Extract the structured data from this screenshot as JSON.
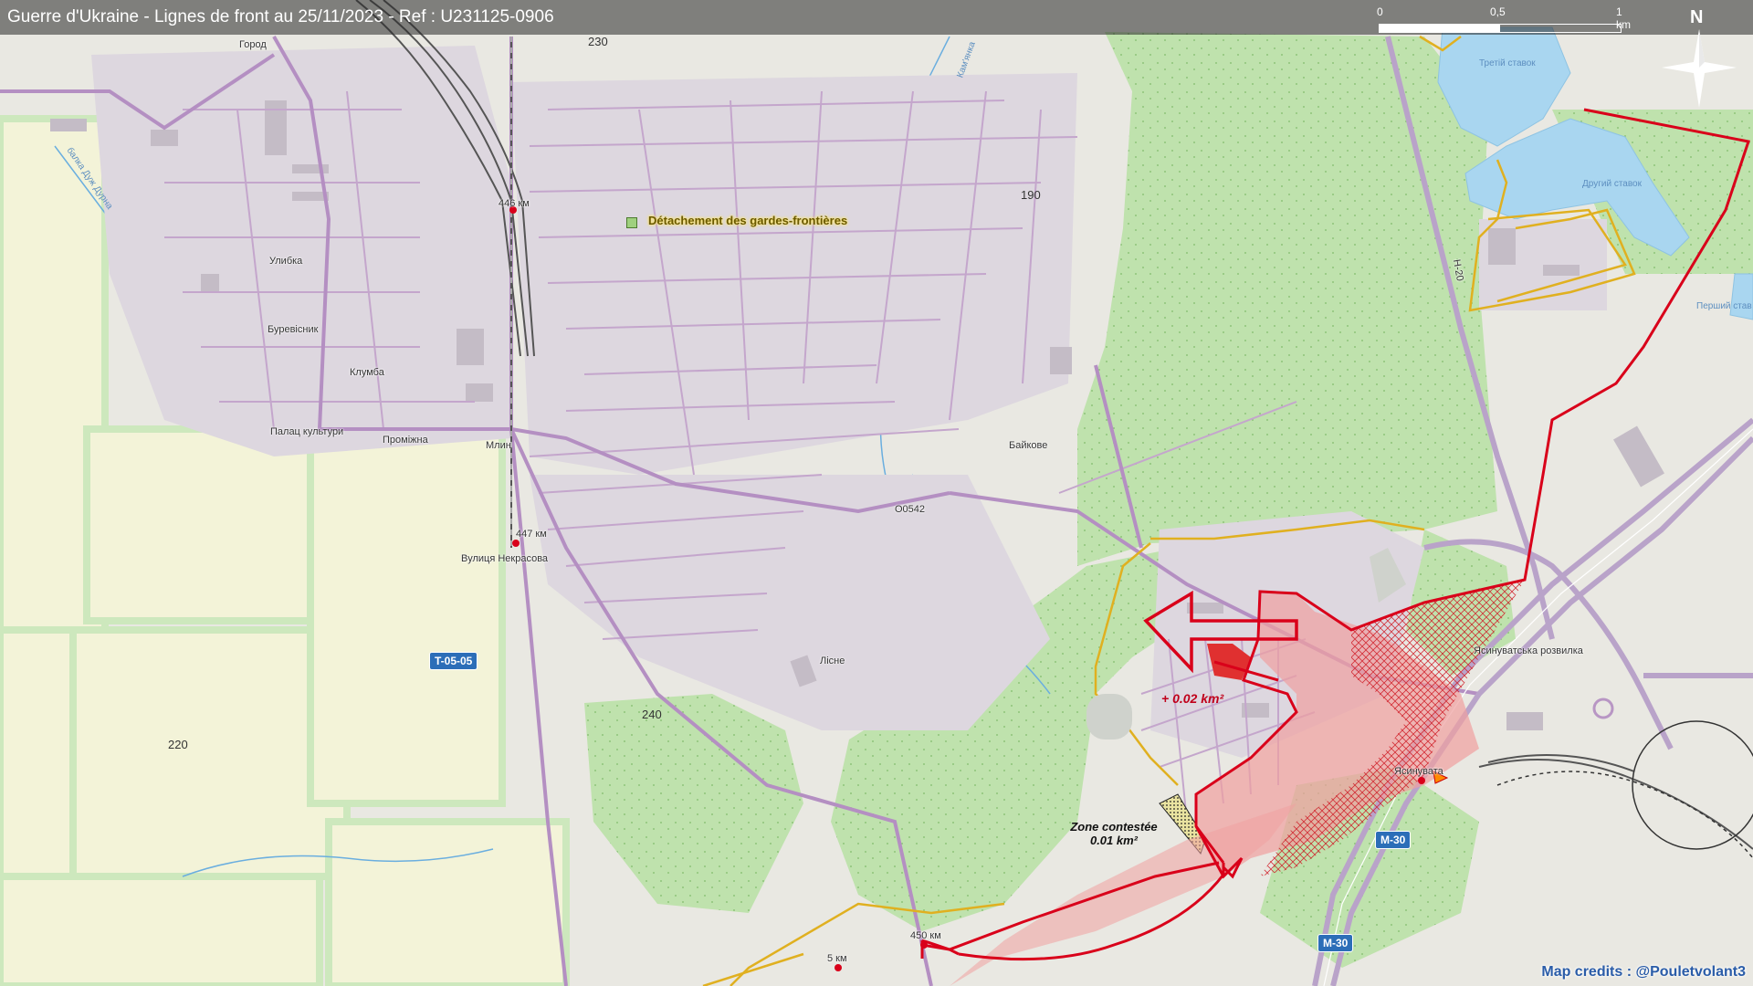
{
  "title": "Guerre d'Ukraine - Lignes de front au 25/11/2023 - Ref : U231125-0906",
  "scale": {
    "labels": [
      "0",
      "0,5",
      "1 km"
    ]
  },
  "north_label": "N",
  "elevations": {
    "e230": "230",
    "e190": "190",
    "e220": "220",
    "e240": "240"
  },
  "places": {
    "horod": "Город",
    "ulybka": "Улибка",
    "burevisnyk": "Буревісник",
    "klumba": "Клумба",
    "palats": "Палац культури",
    "promizhna": "Проміжна",
    "mlyn": "Млин",
    "km446": "446 км",
    "km447": "447 км",
    "km450": "450 км",
    "km5": "5 км",
    "nekrasova": "Вулиця Некрасова",
    "baikove": "Байкове",
    "lisne": "Лісне",
    "yasynuvata": "Ясинувата",
    "rozvylka": "Ясинуватська розвилка",
    "kamianka": "Кам'янка",
    "balka": "балка Дуж Дурна"
  },
  "water_labels": {
    "tretiy": "Третій ставок",
    "druhyi": "Другий ставок",
    "pershyi": "Перший став"
  },
  "roads": {
    "t0505": "T-05-05",
    "m30a": "M-30",
    "m30b": "M-30",
    "o0542": "O0542",
    "n20": "H-20"
  },
  "poi": {
    "border_guards": "Détachement des gardes-frontières"
  },
  "annotations": {
    "gain": "+ 0.02 km²",
    "contested_title": "Zone contestée",
    "contested_area": "0.01 km²"
  },
  "credits": "Map credits : @Pouletvolant3",
  "colors": {
    "background": "#ecebe6",
    "forest": "#b8dfa6",
    "field": "#f2f2d6",
    "road": "#b896c4",
    "water": "#a6d6f2",
    "frontline": "#d9001a",
    "occupied_fill": "#f0a0a0",
    "contested_hatch": "#e03a3a",
    "boundary": "#e0b020"
  }
}
